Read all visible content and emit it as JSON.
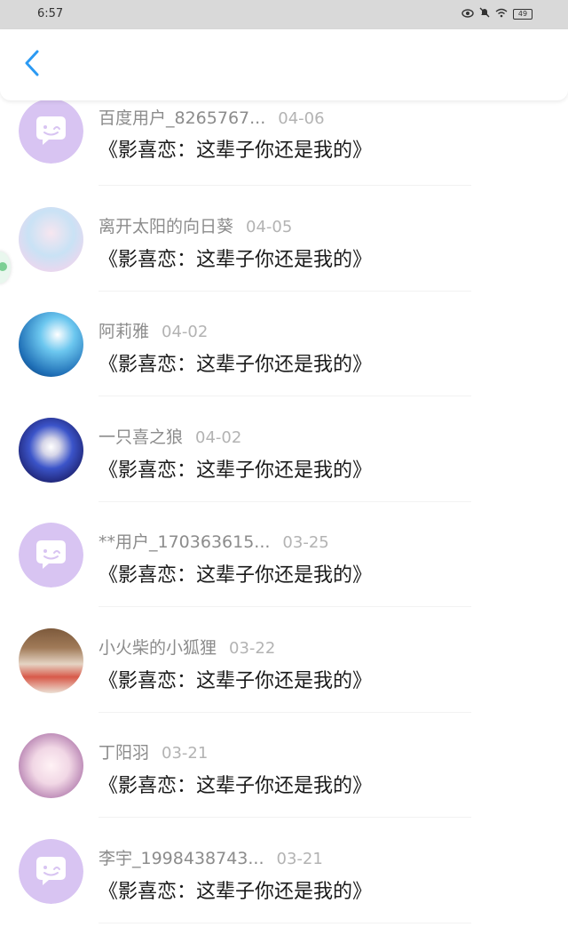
{
  "status_bar": {
    "time": "6:57",
    "battery": "49"
  },
  "comments": [
    {
      "user": "百度用户_8265767...",
      "date": "04-06",
      "text": "《影喜恋：这辈子你还是我的》",
      "avatar": "default-chat-avatar"
    },
    {
      "user": "离开太阳的向日葵",
      "date": "04-05",
      "text": "《影喜恋：这辈子你还是我的》",
      "avatar": "anime-girl-avatar"
    },
    {
      "user": "阿莉雅",
      "date": "04-02",
      "text": "《影喜恋：这辈子你还是我的》",
      "avatar": "anime-blue-avatar"
    },
    {
      "user": "一只喜之狼",
      "date": "04-02",
      "text": "《影喜恋：这辈子你还是我的》",
      "avatar": "cartoon-wolf-avatar"
    },
    {
      "user": "**用户_170363615...",
      "date": "03-25",
      "text": "《影喜恋：这辈子你还是我的》",
      "avatar": "default-chat-avatar"
    },
    {
      "user": "小火柴的小狐狸",
      "date": "03-22",
      "text": "《影喜恋：这辈子你还是我的》",
      "avatar": "group-photo-avatar"
    },
    {
      "user": "丁阳羽",
      "date": "03-21",
      "text": "《影喜恋：这辈子你还是我的》",
      "avatar": "anime-pink-avatar"
    },
    {
      "user": "李宇_1998438743...",
      "date": "03-21",
      "text": "《影喜恋：这辈子你还是我的》",
      "avatar": "default-chat-avatar"
    }
  ],
  "colors": {
    "accent": "#2b9af3",
    "default_avatar": "#d8c4f2"
  }
}
